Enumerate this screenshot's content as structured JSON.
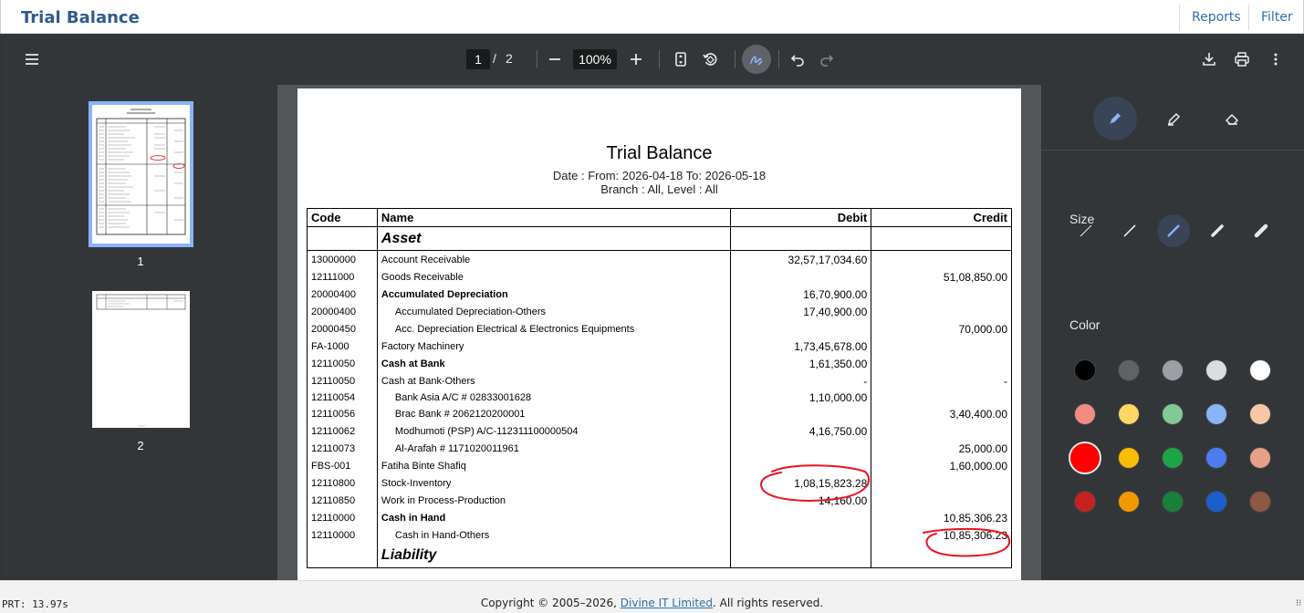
{
  "app": {
    "title": "Trial Balance",
    "links": [
      "Reports",
      "Filter"
    ]
  },
  "viewer": {
    "current_page": "1",
    "separator": "/",
    "total_pages": "2",
    "zoom": "100%"
  },
  "thumbnails": [
    {
      "label": "1"
    },
    {
      "label": "2"
    }
  ],
  "document": {
    "title": "Trial Balance",
    "date_line": "Date : From: 2026-04-18 To: 2026-05-18",
    "branch_line": "Branch : All, Level : All",
    "headers": [
      "Code",
      "Name",
      "Debit",
      "Credit"
    ],
    "sections": [
      {
        "name": "Asset",
        "rows": [
          {
            "code": "13000000",
            "name": "Account Receivable",
            "debit": "32,57,17,034.60",
            "credit": "",
            "style": "normal"
          },
          {
            "code": "12111000",
            "name": "Goods Receivable",
            "debit": "",
            "credit": "51,08,850.00",
            "style": "normal"
          },
          {
            "code": "20000400",
            "name": "Accumulated Depreciation",
            "debit": "16,70,900.00",
            "credit": "",
            "style": "bold"
          },
          {
            "code": "20000400",
            "name": "Accumulated Depreciation-Others",
            "debit": "17,40,900.00",
            "credit": "",
            "style": "indent"
          },
          {
            "code": "20000450",
            "name": "Acc. Depreciation Electrical & Electronics Equipments",
            "debit": "",
            "credit": "70,000.00",
            "style": "indent"
          },
          {
            "code": "FA-1000",
            "name": "Factory Machinery",
            "debit": "1,73,45,678.00",
            "credit": "",
            "style": "normal"
          },
          {
            "code": "12110050",
            "name": "Cash at Bank",
            "debit": "1,61,350.00",
            "credit": "",
            "style": "bold"
          },
          {
            "code": "12110050",
            "name": "Cash at Bank-Others",
            "debit": "-",
            "credit": "-",
            "style": "normal"
          },
          {
            "code": "12110054",
            "name": "Bank Asia A/C # 02833001628",
            "debit": "1,10,000.00",
            "credit": "",
            "style": "indent"
          },
          {
            "code": "12110056",
            "name": "Brac Bank # 2062120200001",
            "debit": "",
            "credit": "3,40,400.00",
            "style": "indent"
          },
          {
            "code": "12110062",
            "name": "Modhumoti (PSP) A/C-112311100000504",
            "debit": "4,16,750.00",
            "credit": "",
            "style": "indent"
          },
          {
            "code": "12110073",
            "name": "Al-Arafah # 1171020011961",
            "debit": "",
            "credit": "25,000.00",
            "style": "indent"
          },
          {
            "code": "FBS-001",
            "name": "Fatiha Binte Shafiq",
            "debit": "",
            "credit": "1,60,000.00",
            "style": "normal"
          },
          {
            "code": "12110800",
            "name": "Stock-Inventory",
            "debit": "1,08,15,823.28",
            "credit": "",
            "style": "normal"
          },
          {
            "code": "12110850",
            "name": "Work in Process-Production",
            "debit": "14,160.00",
            "credit": "",
            "style": "normal"
          },
          {
            "code": "12110000",
            "name": "Cash in Hand",
            "debit": "",
            "credit": "10,85,306.23",
            "style": "bold"
          },
          {
            "code": "12110000",
            "name": "Cash in Hand-Others",
            "debit": "",
            "credit": "10,85,306.23",
            "style": "indent"
          }
        ]
      },
      {
        "name": "Liability",
        "rows": []
      }
    ]
  },
  "annotation_panel": {
    "size_label": "Size",
    "color_label": "Color",
    "colors": [
      "#000000",
      "#5f6368",
      "#9aa0a6",
      "#dadce0",
      "#ffffff",
      "#f28b82",
      "#fdd663",
      "#81c995",
      "#8ab4f8",
      "#f6c7a9",
      "#ff0000",
      "#fbbc04",
      "#1ea446",
      "#4c7cf0",
      "#e8a088",
      "#c5221f",
      "#f29900",
      "#188038",
      "#1a5fcb",
      "#8d5844"
    ],
    "annotation_color": "#e8131f"
  },
  "footer": {
    "timer": "PRT: 13.97s",
    "copyright_prefix": "Copyright © 2005–2026, ",
    "company": "Divine IT Limited",
    "copyright_suffix": ". All rights reserved."
  }
}
